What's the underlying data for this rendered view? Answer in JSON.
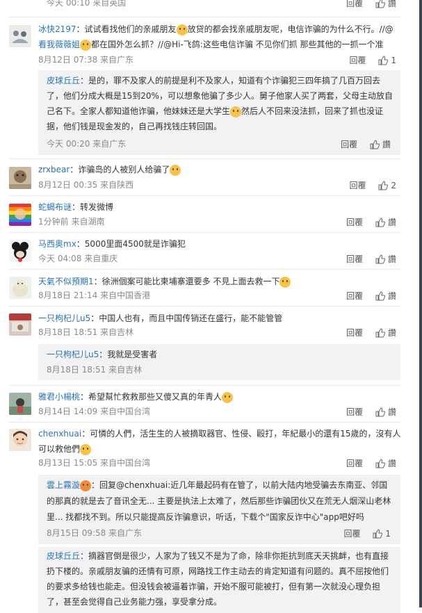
{
  "actions": {
    "reply": "回覆",
    "like_label": "讚"
  },
  "top_partial": {
    "meta": "今天 00:10 来自英国"
  },
  "comments": [
    {
      "name": "冰快2197",
      "text_lines": [
        "：试试看找他们的亲戚朋友",
        "放贷的都会找亲戚朋友呢，电信诈骗的为什么不行。//@",
        "看我薇薇姐",
        "都在国外怎么抓？//@Hi-飞鸽:这些电信诈骗 不见你们抓 那些其他的一抓一个准"
      ],
      "meta": "8月12日 07:38 来自广东",
      "likes": "1"
    },
    {
      "name": "zrxbear",
      "text_lines": [
        "：诈骗岛的人被别人给骗了"
      ],
      "meta": "8月12日 00:35 来自陕西",
      "likes": "2"
    },
    {
      "name": "蛇蝎布谜",
      "text_lines": [
        "：转发微博"
      ],
      "meta": "1分钟前 来自湖南",
      "likes": ""
    },
    {
      "name": "马西奥mx",
      "text_lines": [
        "：5000里面4500就是诈骗犯"
      ],
      "meta": "今天 04:08 来自重庆",
      "likes": ""
    },
    {
      "name": "天氣不似預期1",
      "text_lines": [
        "：徐洲個案可能比柬埔寨還要多 不見上面去救一下"
      ],
      "meta": "8月18日 21:14 来自中国香港",
      "likes": ""
    },
    {
      "name": "一只枸杞儿u5",
      "text_lines": [
        "：中国人也有，而且中国传销还在盛行，能不能管管"
      ],
      "meta": "8月18日 18:51 来自吉林",
      "likes": ""
    },
    {
      "name": "雅君小楊桃",
      "text_lines": [
        "：希望幫忙救救那些又傻又真的年青人"
      ],
      "meta": "8月14日 14:09 来自中国台湾",
      "likes": ""
    },
    {
      "name": "chenxhuai",
      "text_lines": [
        "：可憐的人們，活生生的人被摘取器官、性侵、毆打，年紀最小的還有15歲的，沒有人",
        "可以救他們"
      ],
      "meta": "8月13日 15:05 来自中国台湾",
      "likes": ""
    }
  ],
  "replies": [
    {
      "name": "皮球丘丘",
      "text_lines": [
        "：是的，罪不及家人的前提是利不及家人，知道有个诈骗犯三四年搞了几百万回去",
        "了，他们分成大概是15到20%，可以想象他骗了多少人。舅子他家人买了两套，父母主动放自",
        "己名下。全家人都知道他诈骗，他妹妹还是大学生",
        "然后人不回来没法抓，回来了抓也没证",
        "据，他们钱是现金发的，自己再找钱庄转回国。"
      ],
      "meta": "今天 00:20 来自广东",
      "likes": ""
    },
    {
      "name": "一只枸杞儿u5",
      "text_lines": [
        "：我就是受害者"
      ],
      "meta": "8月18日 18:51 来自吉林",
      "likes": ""
    },
    {
      "name": "雲上霧漩",
      "text_lines": [
        "：回复@chenxhuai:近几年最起码有在管了，以前大陆内地受骗去东南亚、邻国",
        "的那真的就是去了音讯全无... 主要是执法上太难了，然后那些诈骗团伙又在荒无人烟深山老林",
        "里... 找都找不到。所以只能提高反诈骗意识，听话，下载个\"国家反诈中心\"app吧好吗"
      ],
      "meta": "8月15日 09:58 来自广东",
      "likes": "1"
    },
    {
      "name": "皮球丘丘",
      "text_lines": [
        "：摘器官倒是很少，人家为了钱又不是为了命，除非你拒抗到底天天挑衅，也有直接",
        "扔下楼的。亲戚朋友骗的还情有可原，网路找工作主动去的肯定知道有问题的。真不屈按他们",
        "的要求多给钱也能走。但没钱会被逼着诈骗，开始不服可能被打，但有第一次就没心理负担",
        "了，甚至会觉得自己业务能力强，享受拿分成。"
      ],
      "meta": "",
      "likes": ""
    }
  ]
}
